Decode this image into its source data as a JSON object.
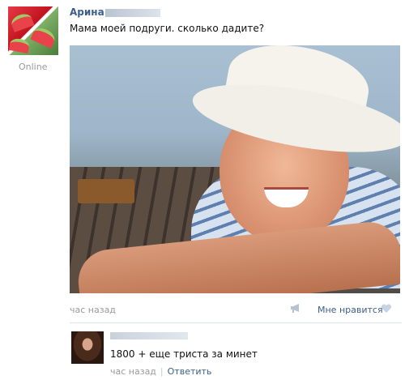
{
  "post": {
    "author_name": "Арина",
    "status": "Online",
    "text": "Мама моей подруги. сколько дадите?",
    "time": "час назад",
    "like_label": "Мне нравится"
  },
  "comment": {
    "text": "1800 + еще триста за минет",
    "time": "час назад",
    "separator": "|",
    "reply_label": "Ответить"
  },
  "icons": {
    "share": "megaphone-icon",
    "like": "heart-icon"
  },
  "colors": {
    "link": "#3b5f8a",
    "muted": "#9a9a9a"
  }
}
